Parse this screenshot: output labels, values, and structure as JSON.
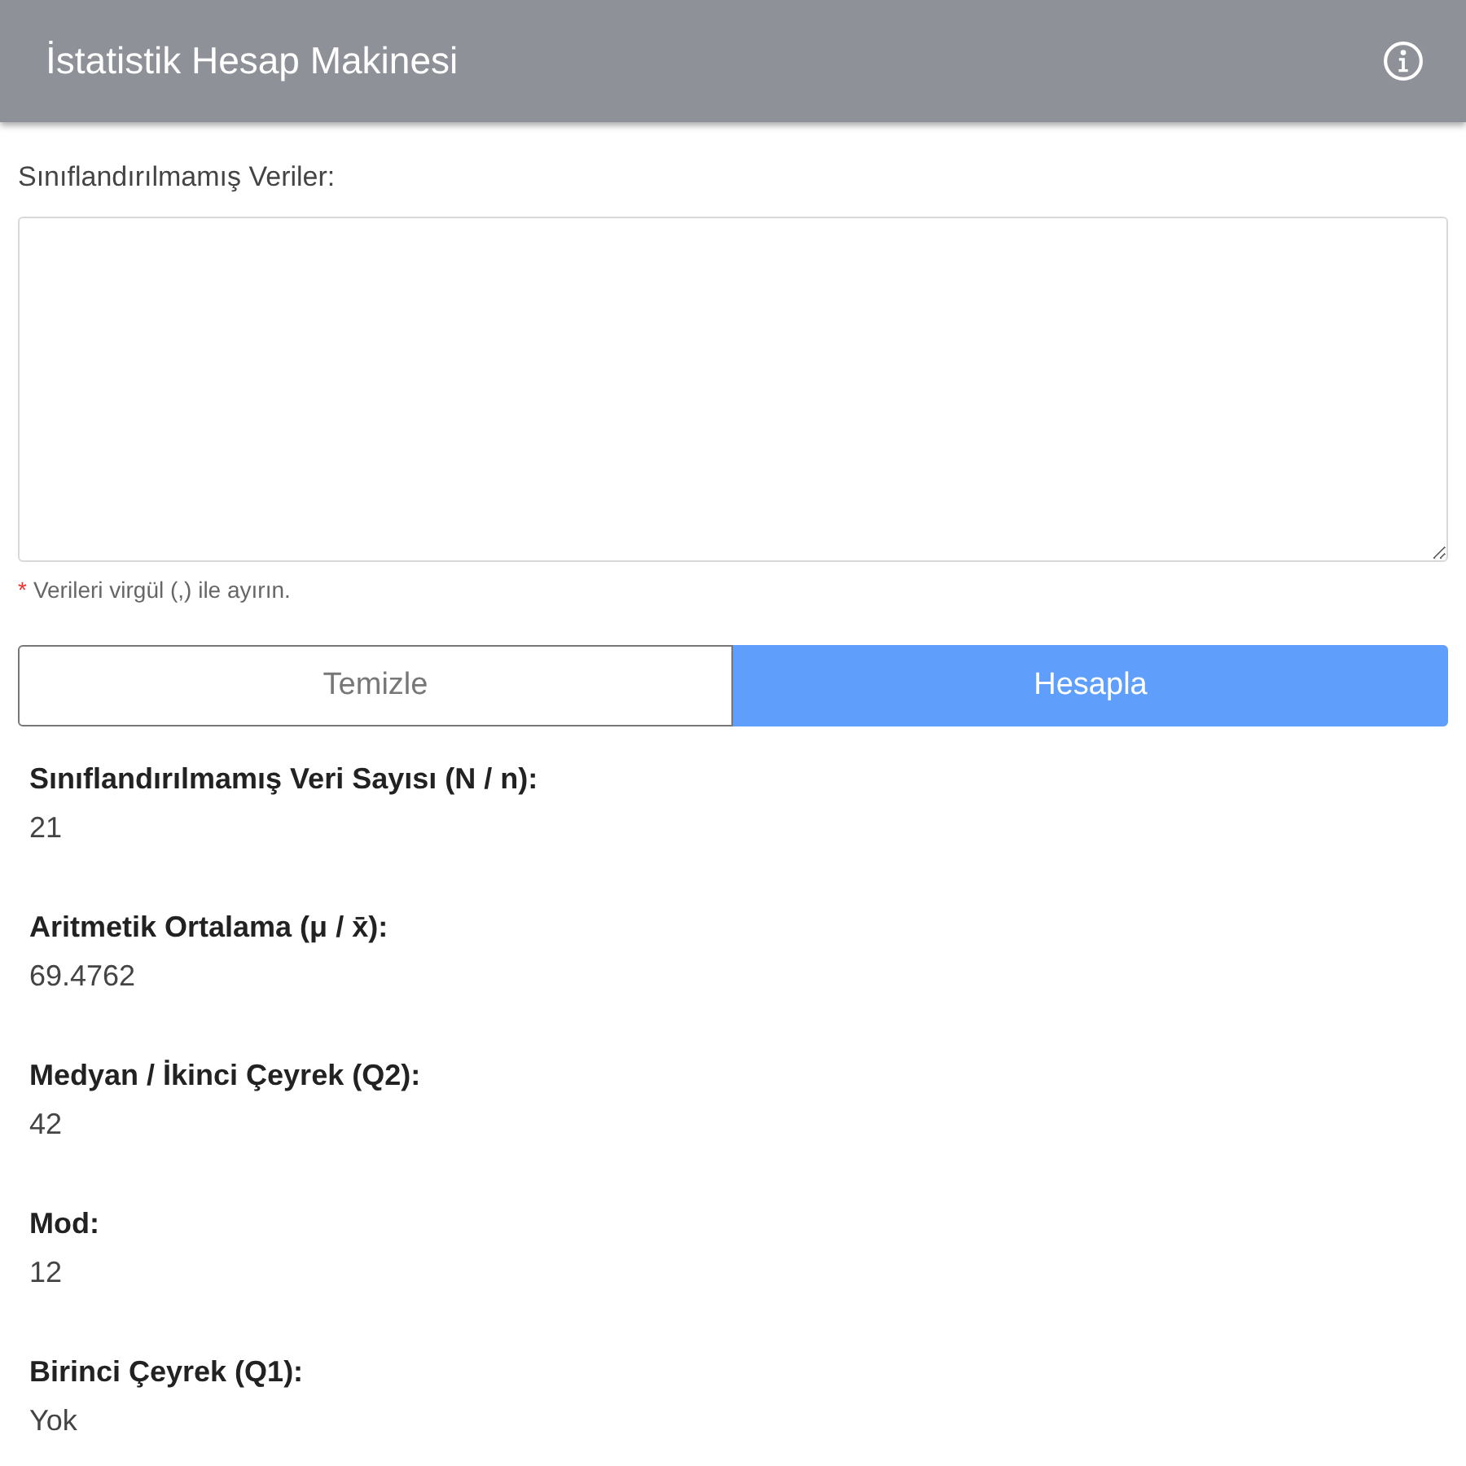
{
  "header": {
    "title": "İstatistik Hesap Makinesi"
  },
  "data_input": {
    "label": "Sınıflandırılmamış Veriler:",
    "note": {
      "mark": "*",
      "text": "Verileri virgül (,) ile ayırın."
    }
  },
  "buttons": [
    {
      "label": "Temizle",
      "kind": "secondary"
    },
    {
      "label": "Hesapla",
      "kind": "primary"
    }
  ],
  "results": [
    {
      "label": "Sınıflandırılmamış Veri Sayısı (N / n):",
      "value": "21"
    },
    {
      "label": "Aritmetik Ortalama (μ / x̄):",
      "value": "69.4762"
    },
    {
      "label": "Medyan / İkinci Çeyrek (Q2):",
      "value": "42"
    },
    {
      "label": "Mod:",
      "value": "12"
    },
    {
      "label": "Birinci Çeyrek (Q1):",
      "value": "Yok"
    }
  ]
}
